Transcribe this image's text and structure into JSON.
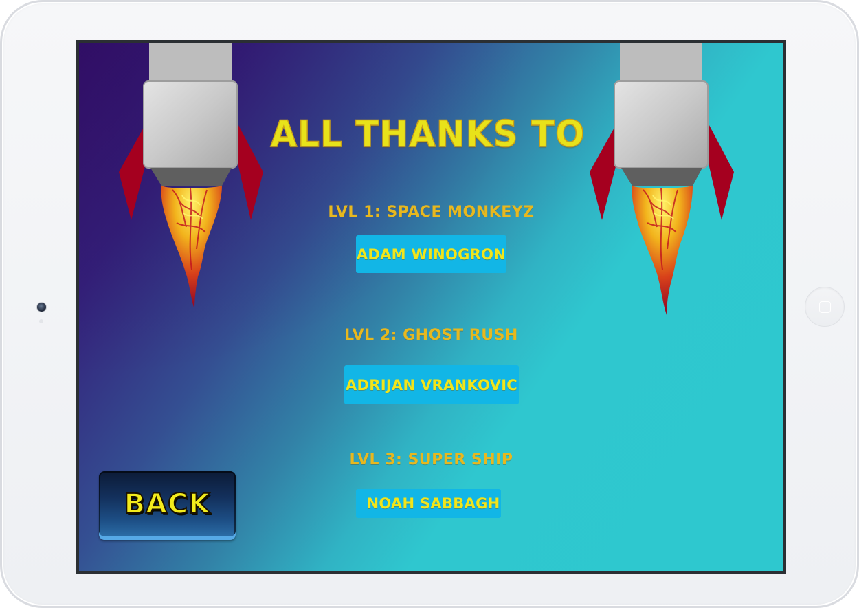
{
  "screen": {
    "title": "ALL THANKS TO",
    "credits": [
      {
        "level": "LVL 1: SPACE MONKEYZ",
        "name": "ADAM WINOGRON"
      },
      {
        "level": "LVL 2: GHOST RUSH",
        "name": "ADRIJAN VRANKOVIC"
      },
      {
        "level": "LVL 3: SUPER SHIP",
        "name": "NOAH SABBAGH"
      }
    ],
    "back_label": "BACK"
  },
  "colors": {
    "background_start": "#35106b",
    "background_end": "#2ec8cf",
    "title": "#e8e21a",
    "level_label": "#e7b81f",
    "credit_bg": "#12b6e6",
    "credit_text": "#f1e51b",
    "rocket_fin": "#a5001f",
    "rocket_body": "#bdbdbd"
  },
  "icons": {
    "left_rocket": "rocket-icon",
    "right_rocket": "rocket-icon",
    "camera": "front-camera",
    "home": "home-button"
  }
}
